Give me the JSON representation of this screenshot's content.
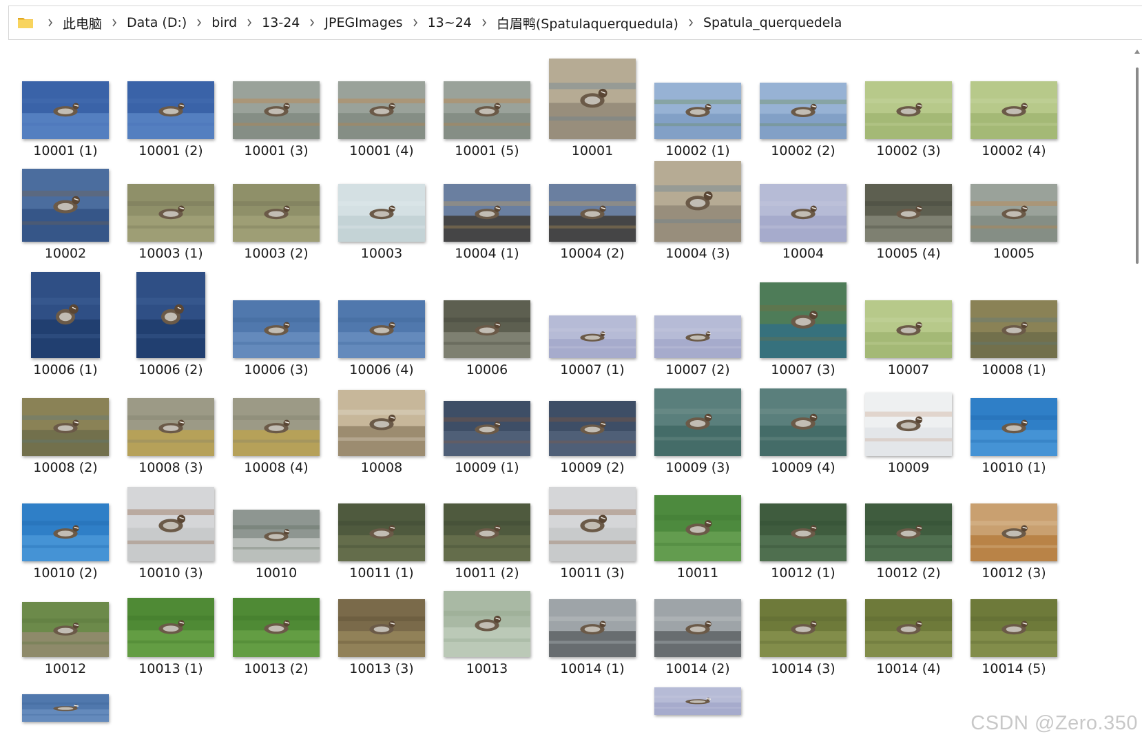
{
  "breadcrumb": {
    "icon": "folder-icon",
    "items": [
      "此电脑",
      "Data (D:)",
      "bird",
      "13-24",
      "JPEGImages",
      "13~24",
      "白眉鸭(Spatulaquerquedula)",
      "Spatula_querquedela"
    ]
  },
  "files": [
    {
      "name": "10001 (1)",
      "scene": "blue-water"
    },
    {
      "name": "10001 (2)",
      "scene": "blue-water"
    },
    {
      "name": "10001 (3)",
      "scene": "grey-orange"
    },
    {
      "name": "10001 (4)",
      "scene": "grey-orange"
    },
    {
      "name": "10001 (5)",
      "scene": "grey-orange"
    },
    {
      "name": "10001",
      "scene": "duck-closeup"
    },
    {
      "name": "10002 (1)",
      "scene": "light-blue-pair"
    },
    {
      "name": "10002 (2)",
      "scene": "light-blue-pair"
    },
    {
      "name": "10002 (3)",
      "scene": "green-water"
    },
    {
      "name": "10002 (4)",
      "scene": "green-water"
    },
    {
      "name": "10002",
      "scene": "flapping"
    },
    {
      "name": "10003 (1)",
      "scene": "olive-water"
    },
    {
      "name": "10003 (2)",
      "scene": "olive-water"
    },
    {
      "name": "10003",
      "scene": "pale-water"
    },
    {
      "name": "10004 (1)",
      "scene": "rocks-dark"
    },
    {
      "name": "10004 (2)",
      "scene": "rocks-dark"
    },
    {
      "name": "10004 (3)",
      "scene": "duck-closeup"
    },
    {
      "name": "10004",
      "scene": "lavender-water"
    },
    {
      "name": "10005 (4)",
      "scene": "reeds-grey"
    },
    {
      "name": "10005",
      "scene": "grey-orange"
    },
    {
      "name": "10006 (1)",
      "scene": "deep-blue"
    },
    {
      "name": "10006 (2)",
      "scene": "deep-blue"
    },
    {
      "name": "10006 (3)",
      "scene": "blue-ripple"
    },
    {
      "name": "10006 (4)",
      "scene": "blue-ripple"
    },
    {
      "name": "10006",
      "scene": "reeds-grey"
    },
    {
      "name": "10007 (1)",
      "scene": "lavender-water"
    },
    {
      "name": "10007 (2)",
      "scene": "lavender-water"
    },
    {
      "name": "10007 (3)",
      "scene": "green-reflect"
    },
    {
      "name": "10007",
      "scene": "green-water"
    },
    {
      "name": "10008 (1)",
      "scene": "brown-bank"
    },
    {
      "name": "10008 (2)",
      "scene": "brown-bank"
    },
    {
      "name": "10008 (3)",
      "scene": "sandy-water"
    },
    {
      "name": "10008 (4)",
      "scene": "sandy-water"
    },
    {
      "name": "10008",
      "scene": "duck-rock"
    },
    {
      "name": "10009 (1)",
      "scene": "slate-blue"
    },
    {
      "name": "10009 (2)",
      "scene": "slate-blue"
    },
    {
      "name": "10009 (3)",
      "scene": "teal-green"
    },
    {
      "name": "10009 (4)",
      "scene": "teal-green"
    },
    {
      "name": "10009",
      "scene": "white-snow"
    },
    {
      "name": "10010 (1)",
      "scene": "bright-blue"
    },
    {
      "name": "10010 (2)",
      "scene": "bright-blue"
    },
    {
      "name": "10010 (3)",
      "scene": "pale-grey"
    },
    {
      "name": "10010",
      "scene": "grey-splash"
    },
    {
      "name": "10011 (1)",
      "scene": "dark-olive"
    },
    {
      "name": "10011 (2)",
      "scene": "dark-olive"
    },
    {
      "name": "10011 (3)",
      "scene": "pale-grey"
    },
    {
      "name": "10011",
      "scene": "grass-green"
    },
    {
      "name": "10012 (1)",
      "scene": "dark-green"
    },
    {
      "name": "10012 (2)",
      "scene": "dark-green"
    },
    {
      "name": "10012 (3)",
      "scene": "orange-sand"
    },
    {
      "name": "10012",
      "scene": "grass-shore"
    },
    {
      "name": "10013 (1)",
      "scene": "grass-duck"
    },
    {
      "name": "10013 (2)",
      "scene": "grass-duck"
    },
    {
      "name": "10013 (3)",
      "scene": "reeds-brown"
    },
    {
      "name": "10013",
      "scene": "pale-green-water"
    },
    {
      "name": "10014 (1)",
      "scene": "grey-cliff"
    },
    {
      "name": "10014 (2)",
      "scene": "grey-cliff"
    },
    {
      "name": "10014 (3)",
      "scene": "olive-grass"
    },
    {
      "name": "10014 (4)",
      "scene": "olive-grass"
    },
    {
      "name": "10014 (5)",
      "scene": "olive-grass"
    }
  ],
  "watermark": "CSDN @Zero.350"
}
